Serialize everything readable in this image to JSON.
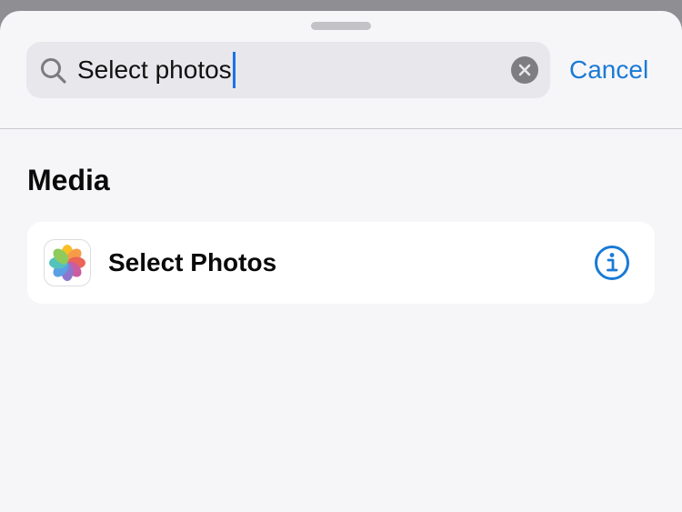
{
  "search": {
    "value": "Select photos",
    "cancel_label": "Cancel"
  },
  "section": {
    "title": "Media"
  },
  "results": [
    {
      "label": "Select Photos",
      "icon": "photos-app-icon",
      "accessory": "info-icon"
    }
  ],
  "colors": {
    "accent": "#1a7ad6",
    "sheet_background": "#f6f6f8",
    "search_field": "#e8e8ec",
    "card": "#ffffff"
  }
}
